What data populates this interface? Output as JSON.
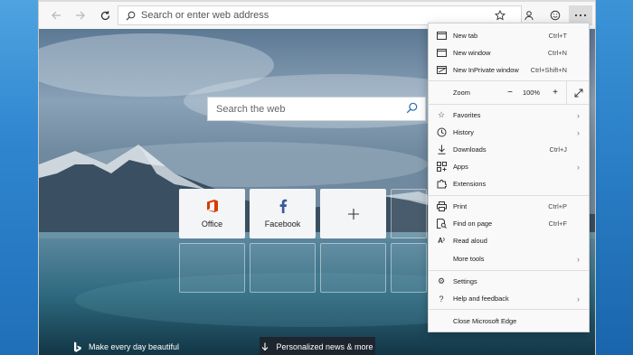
{
  "toolbar": {
    "back_icon": "back-arrow-icon",
    "forward_icon": "forward-arrow-icon",
    "address_placeholder": "Search or enter web address"
  },
  "page": {
    "search_placeholder": "Search the web",
    "tiles": [
      {
        "label": "Office",
        "icon": "office-icon"
      },
      {
        "label": "Facebook",
        "icon": "facebook-icon"
      },
      {
        "label": "",
        "icon": "add-icon"
      }
    ],
    "bing_text": "Make every day beautiful",
    "news_button": "Personalized news & more"
  },
  "menu": {
    "new_tab": {
      "label": "New tab",
      "shortcut": "Ctrl+T"
    },
    "new_window": {
      "label": "New window",
      "shortcut": "Ctrl+N"
    },
    "new_inprivate": {
      "label": "New InPrivate window",
      "shortcut": "Ctrl+Shift+N"
    },
    "zoom": {
      "label": "Zoom",
      "value": "100%"
    },
    "favorites": {
      "label": "Favorites"
    },
    "history": {
      "label": "History"
    },
    "downloads": {
      "label": "Downloads",
      "shortcut": "Ctrl+J"
    },
    "apps": {
      "label": "Apps"
    },
    "extensions": {
      "label": "Extensions"
    },
    "print": {
      "label": "Print",
      "shortcut": "Ctrl+P"
    },
    "find": {
      "label": "Find on page",
      "shortcut": "Ctrl+F"
    },
    "read_aloud": {
      "label": "Read aloud"
    },
    "more_tools": {
      "label": "More tools"
    },
    "settings": {
      "label": "Settings"
    },
    "help": {
      "label": "Help and feedback"
    },
    "close": {
      "label": "Close Microsoft Edge"
    }
  },
  "colors": {
    "office": "#d83b01",
    "facebook": "#3b5998",
    "desktop": "#2b7bc0"
  }
}
